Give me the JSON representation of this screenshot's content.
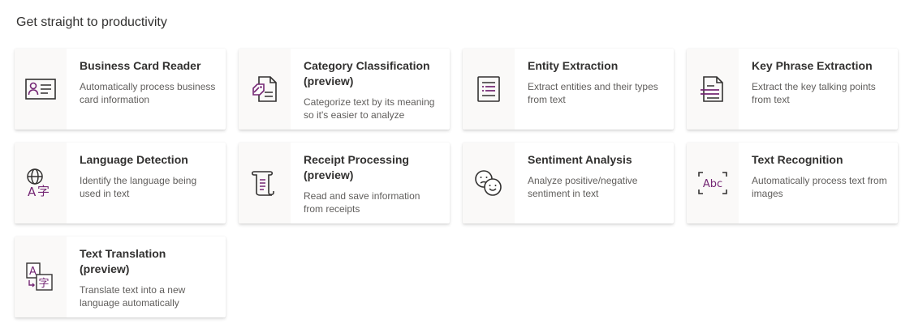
{
  "page": {
    "heading": "Get straight to productivity"
  },
  "colors": {
    "accent": "#742774",
    "icon_stroke": "#323130",
    "icon_panel": "#faf9f8"
  },
  "cards": [
    {
      "title": "Business Card Reader",
      "description": "Automatically process business card information",
      "icon": "business-card-icon"
    },
    {
      "title": "Category Classification (preview)",
      "description": "Categorize text by its meaning so it's easier to analyze",
      "icon": "category-classification-icon"
    },
    {
      "title": "Entity Extraction",
      "description": "Extract entities and their types from text",
      "icon": "entity-extraction-icon"
    },
    {
      "title": "Key Phrase Extraction",
      "description": "Extract the key talking points from text",
      "icon": "key-phrase-icon"
    },
    {
      "title": "Language Detection",
      "description": "Identify the language being used in text",
      "icon": "language-detection-icon"
    },
    {
      "title": "Receipt Processing (preview)",
      "description": "Read and save information from receipts",
      "icon": "receipt-icon"
    },
    {
      "title": "Sentiment Analysis",
      "description": "Analyze positive/negative sentiment in text",
      "icon": "sentiment-icon"
    },
    {
      "title": "Text Recognition",
      "description": "Automatically process text from images",
      "icon": "text-recognition-icon"
    },
    {
      "title": "Text Translation (preview)",
      "description": "Translate text into a new language automatically",
      "icon": "translation-icon"
    }
  ],
  "icon_text": {
    "abc": "Abc",
    "letter_a": "A",
    "zi": "字"
  }
}
